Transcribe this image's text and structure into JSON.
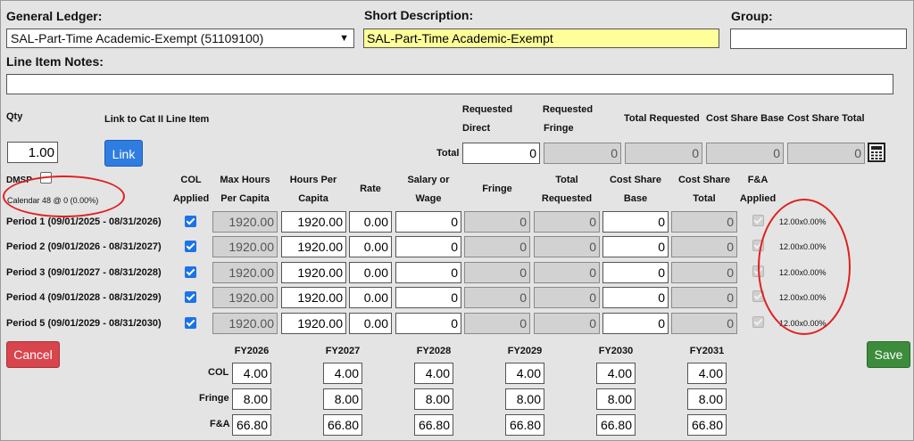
{
  "general_ledger": {
    "label": "General Ledger:",
    "selected": "SAL-Part-Time Academic-Exempt (51109100)"
  },
  "short_description": {
    "label": "Short Description:",
    "value": "SAL-Part-Time Academic-Exempt"
  },
  "group": {
    "label": "Group:",
    "value": ""
  },
  "line_item_notes": {
    "label": "Line Item Notes:",
    "value": ""
  },
  "qty": {
    "label": "Qty",
    "value": "1.00"
  },
  "link_cat2": {
    "label": "Link to Cat II Line Item",
    "button": "Link"
  },
  "totals": {
    "label": "Total",
    "requested_direct_label1": "Requested",
    "requested_direct_label2": "Direct",
    "requested_direct": "0",
    "requested_fringe_label1": "Requested",
    "requested_fringe_label2": "Fringe",
    "requested_fringe": "0",
    "total_requested_label": "Total Requested",
    "total_requested": "0",
    "cost_share_base_label": "Cost Share Base",
    "cost_share_base": "0",
    "cost_share_total_label": "Cost Share Total",
    "cost_share_total": "0",
    "calculator_icon": "calculator-icon"
  },
  "dmsp": {
    "label": "DMSP",
    "checked": false
  },
  "calendar_text": "Calendar 48 @ 0 (0.00%)",
  "columns": {
    "col_applied": [
      "COL",
      "Applied"
    ],
    "max_hours": [
      "Max Hours",
      "Per Capita"
    ],
    "hours_per_capita": [
      "Hours Per",
      "Capita"
    ],
    "rate": [
      "Rate"
    ],
    "salary": [
      "Salary or",
      "Wage"
    ],
    "fringe": [
      "Fringe"
    ],
    "total_requested": [
      "Total",
      "Requested"
    ],
    "cost_share_base": [
      "Cost Share",
      "Base"
    ],
    "cost_share_total": [
      "Cost Share",
      "Total"
    ],
    "fa_applied": [
      "F&A",
      "Applied"
    ]
  },
  "periods": [
    {
      "label": "Period 1 (09/01/2025 - 08/31/2026)",
      "col_applied": true,
      "max_hours": "1920.00",
      "hours": "1920.00",
      "rate": "0.00",
      "salary": "0",
      "fringe": "0",
      "total_requested": "0",
      "cost_share_base": "0",
      "cost_share_total": "0",
      "fa_applied": true,
      "note": "12.00x0.00%"
    },
    {
      "label": "Period 2 (09/01/2026 - 08/31/2027)",
      "col_applied": true,
      "max_hours": "1920.00",
      "hours": "1920.00",
      "rate": "0.00",
      "salary": "0",
      "fringe": "0",
      "total_requested": "0",
      "cost_share_base": "0",
      "cost_share_total": "0",
      "fa_applied": true,
      "note": "12.00x0.00%"
    },
    {
      "label": "Period 3 (09/01/2027 - 08/31/2028)",
      "col_applied": true,
      "max_hours": "1920.00",
      "hours": "1920.00",
      "rate": "0.00",
      "salary": "0",
      "fringe": "0",
      "total_requested": "0",
      "cost_share_base": "0",
      "cost_share_total": "0",
      "fa_applied": true,
      "note": "12.00x0.00%"
    },
    {
      "label": "Period 4 (09/01/2028 - 08/31/2029)",
      "col_applied": true,
      "max_hours": "1920.00",
      "hours": "1920.00",
      "rate": "0.00",
      "salary": "0",
      "fringe": "0",
      "total_requested": "0",
      "cost_share_base": "0",
      "cost_share_total": "0",
      "fa_applied": true,
      "note": "12.00x0.00%"
    },
    {
      "label": "Period 5 (09/01/2029 - 08/31/2030)",
      "col_applied": true,
      "max_hours": "1920.00",
      "hours": "1920.00",
      "rate": "0.00",
      "salary": "0",
      "fringe": "0",
      "total_requested": "0",
      "cost_share_base": "0",
      "cost_share_total": "0",
      "fa_applied": true,
      "note": "12.00x0.00%"
    }
  ],
  "rates": {
    "row_labels": {
      "col": "COL",
      "fringe": "Fringe",
      "fa": "F&A"
    },
    "years": [
      {
        "fy": "FY2026",
        "col": "4.00",
        "fringe": "8.00",
        "fa": "66.80"
      },
      {
        "fy": "FY2027",
        "col": "4.00",
        "fringe": "8.00",
        "fa": "66.80"
      },
      {
        "fy": "FY2028",
        "col": "4.00",
        "fringe": "8.00",
        "fa": "66.80"
      },
      {
        "fy": "FY2029",
        "col": "4.00",
        "fringe": "8.00",
        "fa": "66.80"
      },
      {
        "fy": "FY2030",
        "col": "4.00",
        "fringe": "8.00",
        "fa": "66.80"
      },
      {
        "fy": "FY2031",
        "col": "4.00",
        "fringe": "8.00",
        "fa": "66.80"
      }
    ]
  },
  "buttons": {
    "cancel": "Cancel",
    "save": "Save"
  },
  "colors": {
    "link_button": "#2f7de1",
    "cancel_button": "#d9454d",
    "save_button": "#3c8c3c",
    "short_description_bg": "#ffff99",
    "annotation": "#e02020"
  }
}
